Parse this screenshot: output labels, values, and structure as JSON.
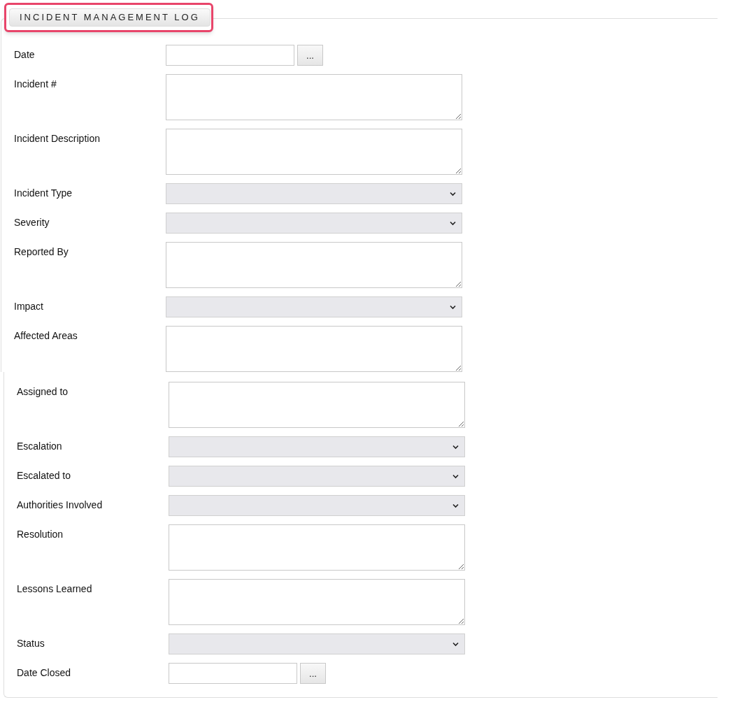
{
  "header": {
    "title": "INCIDENT MANAGEMENT LOG"
  },
  "sections": [
    {
      "fields": [
        {
          "label": "Date",
          "kind": "date",
          "button": "..."
        },
        {
          "label": "Incident #",
          "kind": "textarea"
        },
        {
          "label": "Incident Description",
          "kind": "textarea"
        },
        {
          "label": "Incident Type",
          "kind": "select"
        },
        {
          "label": "Severity",
          "kind": "select"
        },
        {
          "label": "Reported By",
          "kind": "textarea"
        },
        {
          "label": "Impact",
          "kind": "select"
        },
        {
          "label": "Affected Areas",
          "kind": "textarea"
        }
      ]
    },
    {
      "fields": [
        {
          "label": "Assigned to",
          "kind": "textarea"
        },
        {
          "label": "Escalation",
          "kind": "select"
        },
        {
          "label": "Escalated to",
          "kind": "select"
        },
        {
          "label": "Authorities Involved",
          "kind": "select"
        },
        {
          "label": "Resolution",
          "kind": "textarea"
        },
        {
          "label": "Lessons Learned",
          "kind": "textarea"
        },
        {
          "label": "Status",
          "kind": "select"
        },
        {
          "label": "Date Closed",
          "kind": "date",
          "button": "..."
        }
      ]
    }
  ]
}
